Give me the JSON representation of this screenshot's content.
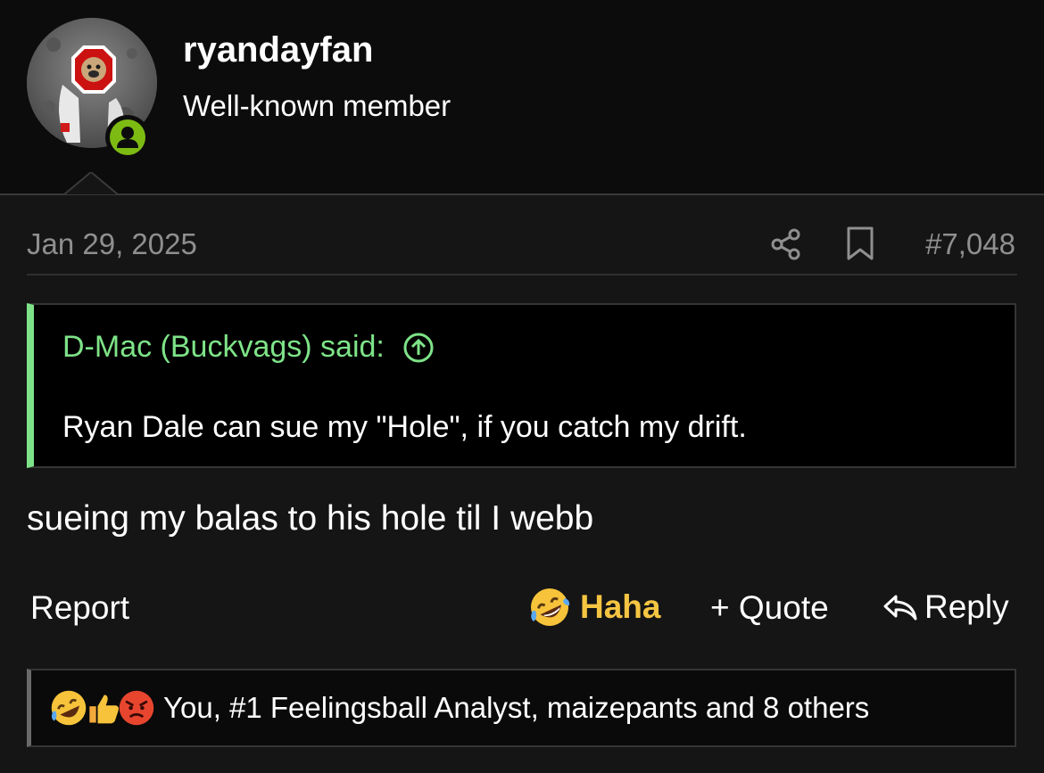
{
  "user": {
    "name": "ryandayfan",
    "title": "Well-known member",
    "avatar_icon": "pug-block-o-avatar",
    "status_icon": "online-user-icon"
  },
  "post": {
    "date": "Jan 29, 2025",
    "number": "#7,048",
    "share_icon": "share-icon",
    "bookmark_icon": "bookmark-icon"
  },
  "quote": {
    "author": "D-Mac (Buckvags) said:",
    "text": "Ryan Dale can sue my \"Hole\", if you catch my drift.",
    "jump_icon": "arrow-up-circle-icon"
  },
  "message": "sueing my balas to his hole til I webb",
  "actions": {
    "report": "Report",
    "haha": "Haha",
    "quote": "+ Quote",
    "reply": "Reply"
  },
  "reactions": {
    "icons": [
      "rofl-emoji",
      "thumbs-up-emoji",
      "angry-emoji"
    ],
    "summary": "You, #1 Feelingsball Analyst, maizepants and 8 others"
  },
  "colors": {
    "accent_green": "#7ee388",
    "haha_yellow": "#f5c542",
    "online_green": "#7dbb13",
    "muted_text": "#8f8f8f"
  }
}
